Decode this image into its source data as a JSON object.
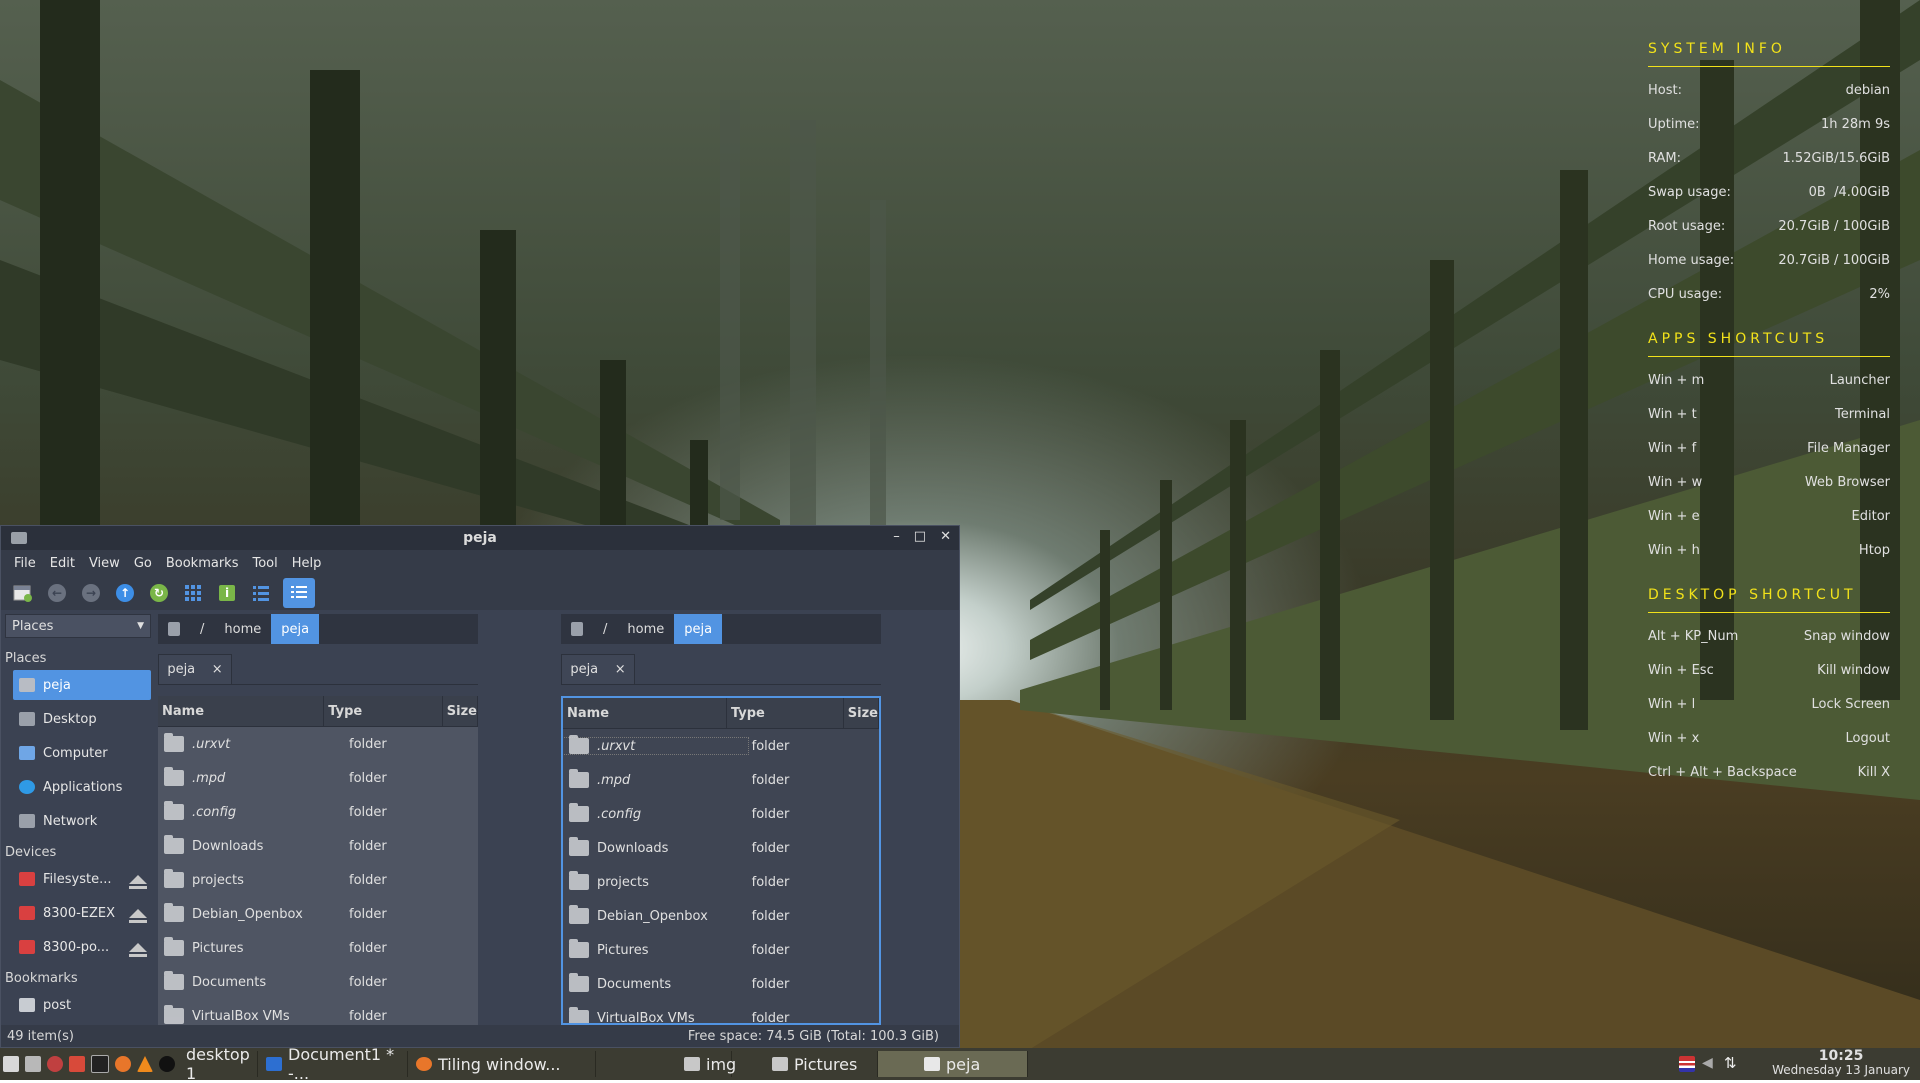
{
  "conky": {
    "system_info": {
      "title": "SYSTEM INFO",
      "rows": [
        {
          "label": "Host:",
          "value": "debian"
        },
        {
          "label": "Uptime:",
          "value": "1h 28m 9s"
        },
        {
          "label": "RAM:",
          "value": "1.52GiB/15.6GiB"
        },
        {
          "label": "Swap usage:",
          "value": "0B  /4.00GiB"
        },
        {
          "label": "Root usage:",
          "value": "20.7GiB / 100GiB"
        },
        {
          "label": "Home usage:",
          "value": "20.7GiB / 100GiB"
        },
        {
          "label": "CPU usage:",
          "value": "2%"
        }
      ]
    },
    "apps_shortcuts": {
      "title": "APPS SHORTCUTS",
      "rows": [
        {
          "label": "Win + m",
          "value": "Launcher"
        },
        {
          "label": "Win + t",
          "value": "Terminal"
        },
        {
          "label": "Win + f",
          "value": "File Manager"
        },
        {
          "label": "Win + w",
          "value": "Web Browser"
        },
        {
          "label": "Win + e",
          "value": "Editor"
        },
        {
          "label": "Win + h",
          "value": "Htop"
        }
      ]
    },
    "desktop_shortcut": {
      "title": "DESKTOP SHORTCUT",
      "rows": [
        {
          "label": "Alt + KP_Num",
          "value": "Snap window"
        },
        {
          "label": "Win + Esc",
          "value": "Kill window"
        },
        {
          "label": "Win + l",
          "value": "Lock Screen"
        },
        {
          "label": "Win + x",
          "value": "Logout"
        },
        {
          "label": "Ctrl + Alt + Backspace",
          "value": "Kill X"
        }
      ]
    }
  },
  "window": {
    "title": "peja",
    "controls": {
      "minimize": "–",
      "maximize": "□",
      "close": "✕"
    },
    "menu": [
      "File",
      "Edit",
      "View",
      "Go",
      "Bookmarks",
      "Tool",
      "Help"
    ],
    "places_dropdown": "Places",
    "sidebar": {
      "places_heading": "Places",
      "places": [
        {
          "label": "peja",
          "icon": "home-icon",
          "selected": true
        },
        {
          "label": "Desktop",
          "icon": "desktop-icon"
        },
        {
          "label": "Computer",
          "icon": "computer-icon"
        },
        {
          "label": "Applications",
          "icon": "applications-icon"
        },
        {
          "label": "Network",
          "icon": "network-icon"
        }
      ],
      "devices_heading": "Devices",
      "devices": [
        {
          "label": "Filesyste..."
        },
        {
          "label": "8300-EZEX"
        },
        {
          "label": "8300-po..."
        }
      ],
      "bookmarks_heading": "Bookmarks",
      "bookmarks": [
        {
          "label": "post"
        }
      ]
    },
    "path": [
      "/",
      "home",
      "peja"
    ],
    "tab_label": "peja",
    "tab_close": "×",
    "columns": {
      "name": "Name",
      "type": "Type",
      "size": "Size"
    },
    "files": [
      {
        "name": ".urxvt",
        "type": "folder",
        "hidden": true
      },
      {
        "name": ".mpd",
        "type": "folder",
        "hidden": true
      },
      {
        "name": ".config",
        "type": "folder",
        "hidden": true
      },
      {
        "name": "Downloads",
        "type": "folder"
      },
      {
        "name": "projects",
        "type": "folder"
      },
      {
        "name": "Debian_Openbox",
        "type": "folder"
      },
      {
        "name": "Pictures",
        "type": "folder"
      },
      {
        "name": "Documents",
        "type": "folder"
      },
      {
        "name": "VirtualBox VMs",
        "type": "folder"
      }
    ],
    "status_left": "49 item(s)",
    "status_right": "Free space: 74.5 GiB (Total: 100.3 GiB)"
  },
  "taskbar": {
    "tasks": [
      {
        "label": "desktop 1"
      },
      {
        "label": "Document1 * -..."
      },
      {
        "label": "Tiling window..."
      },
      {
        "label": "img"
      },
      {
        "label": "Pictures"
      },
      {
        "label": "peja",
        "active": true
      }
    ],
    "time": "10:25",
    "date": "Wednesday 13 January"
  },
  "colors": {
    "accent": "#5294e2",
    "conky": "#f2e21a"
  }
}
